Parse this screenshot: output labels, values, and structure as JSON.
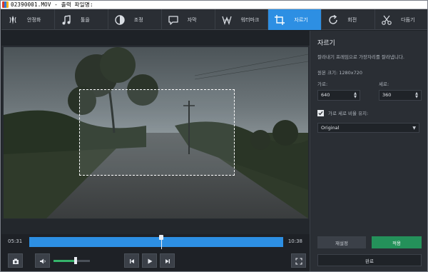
{
  "window": {
    "title": "02390001.MOV - 출력 파일명:"
  },
  "toolbar": {
    "items": [
      {
        "label": "안정화",
        "icon": "stabilize-icon"
      },
      {
        "label": "툴을",
        "icon": "music-icon"
      },
      {
        "label": "조정",
        "icon": "adjust-icon"
      },
      {
        "label": "자막",
        "icon": "caption-icon"
      },
      {
        "label": "워터마크",
        "icon": "watermark-icon"
      },
      {
        "label": "자르기",
        "icon": "crop-icon",
        "active": true
      },
      {
        "label": "회전",
        "icon": "rotate-icon"
      },
      {
        "label": "다듬기",
        "icon": "scissors-icon"
      }
    ],
    "accent": "#2d8fe3"
  },
  "timeline": {
    "start_time": "05:31",
    "end_time": "10:38",
    "playhead_fraction": 0.52
  },
  "controls": {
    "volume_fraction": 0.6
  },
  "panel": {
    "title": "자르기",
    "description": "잘라내기 프레임으로 가장자리를 잘라냅니다.",
    "original_size": "원본 크기: 1280x720",
    "width_label": "가로:",
    "width_value": "640",
    "height_label": "세로:",
    "height_value": "360",
    "keep_ratio_label": "가로 세로 비율 유지:",
    "keep_ratio_checked": true,
    "ratio_value": "Original",
    "reset_label": "재설정",
    "apply_label": "적용",
    "done_label": "완료",
    "apply_color": "#24915a"
  }
}
